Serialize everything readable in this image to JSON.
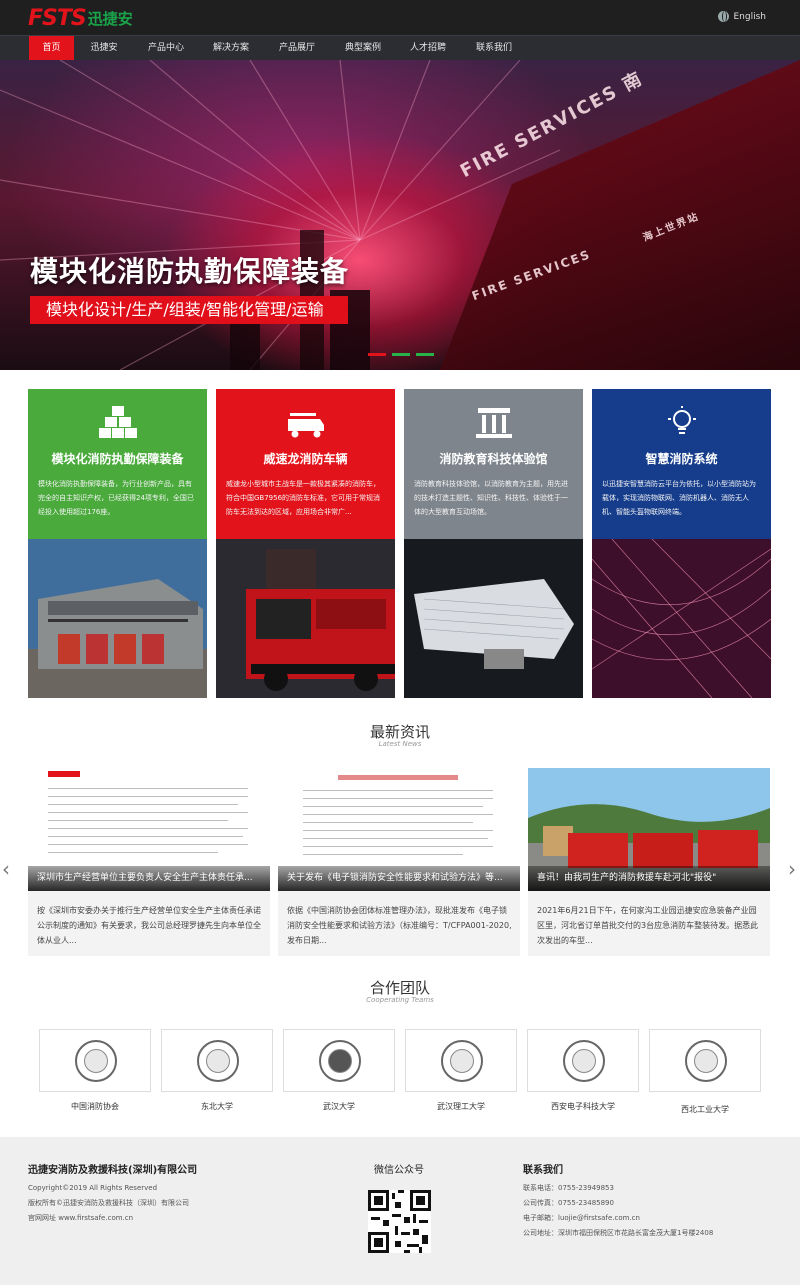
{
  "header": {
    "logo_mark": "FSTS",
    "logo_cn": "迅捷安",
    "language_label": "English"
  },
  "nav": {
    "items": [
      {
        "label": "首页",
        "active": true
      },
      {
        "label": "迅捷安"
      },
      {
        "label": "产品中心"
      },
      {
        "label": "解决方案"
      },
      {
        "label": "产品展厅"
      },
      {
        "label": "典型案例"
      },
      {
        "label": "人才招聘"
      },
      {
        "label": "联系我们"
      }
    ]
  },
  "hero": {
    "title": "模块化消防执勤保障装备",
    "subtitle": "模块化设计/生产/组装/智能化管理/运输",
    "sign_main": "FIRE SERVICES 南",
    "sign_secondary": "FIRE SERVICES",
    "sign_cn": "海上世界站",
    "slider_colors": [
      "#e3131b",
      "#27b34a",
      "#27b34a"
    ]
  },
  "cards": [
    {
      "title": "模块化消防执勤保障装备",
      "desc": "模块化消防执勤保障装备，为行业创新产品，具有完全的自主知识产权，已经获得24项专利，全国已经投入使用超过176座。",
      "color": "#4aaa3c",
      "icon": "boxes-icon"
    },
    {
      "title": "威速龙消防车辆",
      "desc": "威速龙小型城市主战车是一款极其紧凑的消防车，符合中国GB7956的消防车标准，它可用于常规消防车无法到达的区域，应用场合非常广...",
      "color": "#e3131b",
      "icon": "fire-truck-icon"
    },
    {
      "title": "消防教育科技体验馆",
      "desc": "消防教育科技体验馆，以消防教育为主题，用先进的技术打造主题性、知识性、科技性、体验性于一体的大型教育互动场馆。",
      "color": "#7f858c",
      "icon": "pavilion-icon"
    },
    {
      "title": "智慧消防系统",
      "desc": "以迅捷安智慧消防云平台为依托，以小型消防站为载体，实现消防物联网、消防机器人、消防无人机、智能头盔物联网终端。",
      "color": "#163d8c",
      "icon": "lightbulb-icon"
    }
  ],
  "news_section": {
    "title": "最新资讯",
    "subtitle": "Latest News"
  },
  "news": [
    {
      "caption": "深圳市生产经营单位主要负责人安全生产主体责任承...",
      "text": "按《深圳市安委办关于推行生产经营单位安全生产主体责任承诺公示制度的通知》有关要求，我公司总经理罗捷先生向本单位全体从业人..."
    },
    {
      "caption": "关于发布《电子锁消防安全性能要求和试验方法》等...",
      "text": "依据《中国消防协会团体标准管理办法》，现批准发布《电子锁消防安全性能要求和试验方法》（标准编号：T/CFPA001-2020,发布日期..."
    },
    {
      "caption": "喜讯！由我司生产的消防救援车赴河北\"报役\"",
      "text": "2021年6月21日下午，在何家沟工业园迅捷安应急装备产业园区里，河北省订单首批交付的3台应急消防车整装待发。据悉此次发出的车型..."
    }
  ],
  "partners_section": {
    "title": "合作团队",
    "subtitle": "Cooperating Teams"
  },
  "partners": [
    {
      "name": "中国消防协会"
    },
    {
      "name": "东北大学"
    },
    {
      "name": "武汉大学"
    },
    {
      "name": "武汉理工大学"
    },
    {
      "name": "西安电子科技大学"
    },
    {
      "name": "西北工业大学"
    }
  ],
  "footer": {
    "company": "迅捷安消防及救援科技(深圳)有限公司",
    "copyright": "Copyright©2019 All Rights Reserved",
    "rights": "版权所有©迅捷安消防及救援科技（深圳）有限公司",
    "website": "官网网址 www.firstsafe.com.cn",
    "wechat_title": "微信公众号",
    "contact_title": "联系我们",
    "phone": "联系电话：0755-23949853",
    "fax": "公司传真：0755-23485890",
    "email": "电子邮箱：luojie@firstsafe.com.cn",
    "address": "公司地址：深圳市福田保税区市花路长富金茂大厦1号楼2408"
  }
}
